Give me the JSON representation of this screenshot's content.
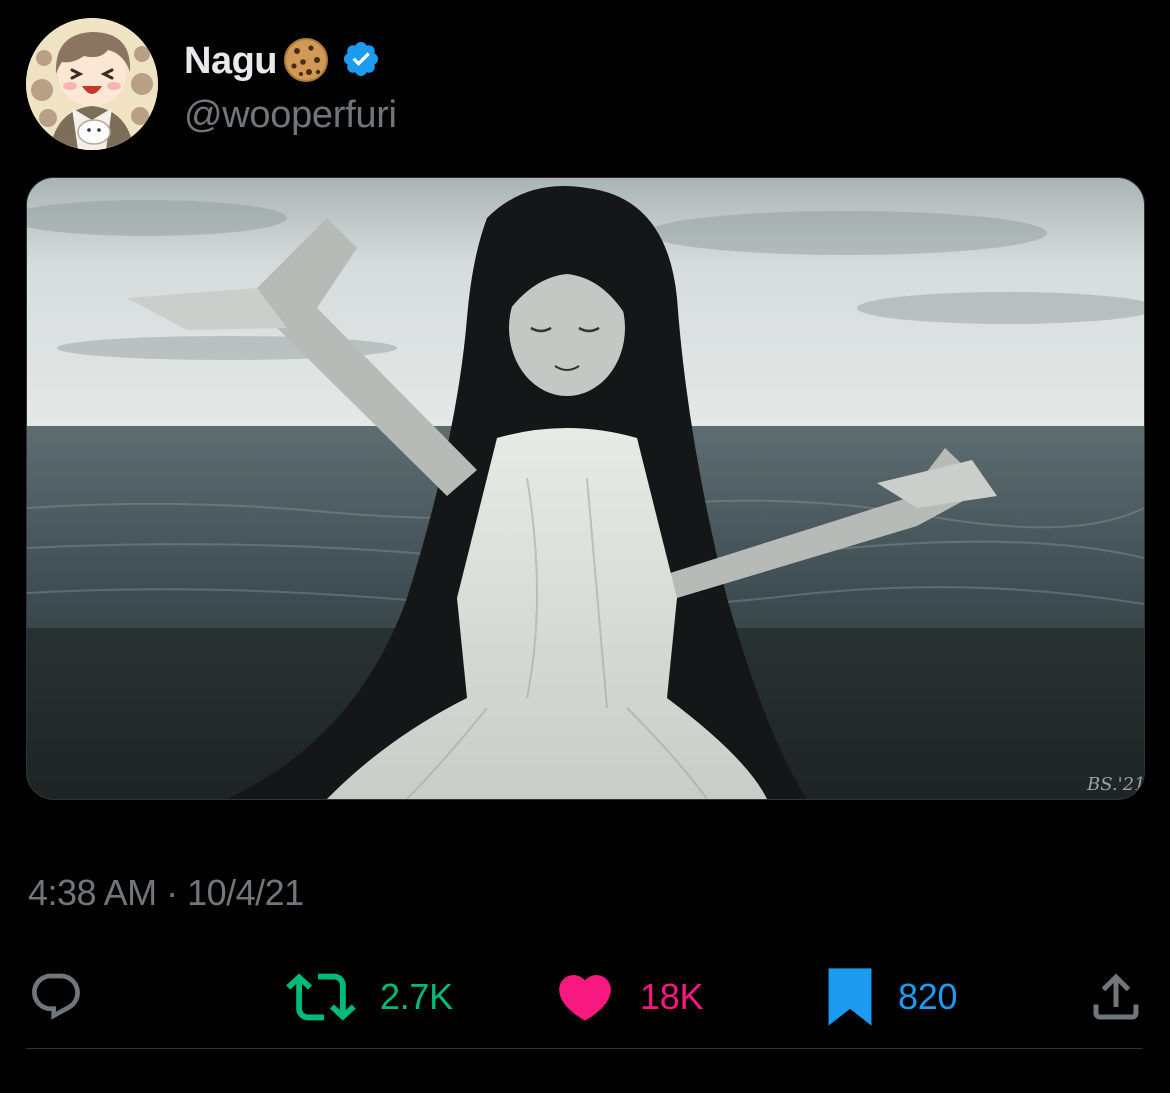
{
  "author": {
    "display_name": "Nagu",
    "handle": "@wooperfuri",
    "verified": true,
    "badge_icon": "verified-badge-icon",
    "emoji_icon": "cookie-emoji-icon",
    "badge_color": "#1d9bf0"
  },
  "tweet": {
    "timestamp": "4:38 AM · 10/4/21",
    "media_signature": "BS.'21"
  },
  "actions": {
    "reply": {
      "icon": "reply-icon",
      "count": ""
    },
    "retweet": {
      "icon": "retweet-icon",
      "count": "2.7K",
      "color": "#00ba7c"
    },
    "like": {
      "icon": "heart-icon",
      "count": "18K",
      "color": "#f91880"
    },
    "bookmark": {
      "icon": "bookmark-icon",
      "count": "820",
      "color": "#1d9bf0"
    },
    "share": {
      "icon": "share-icon"
    }
  },
  "colors": {
    "background": "#000000",
    "primary_text": "#e7e9ea",
    "secondary_text": "#71767b"
  }
}
